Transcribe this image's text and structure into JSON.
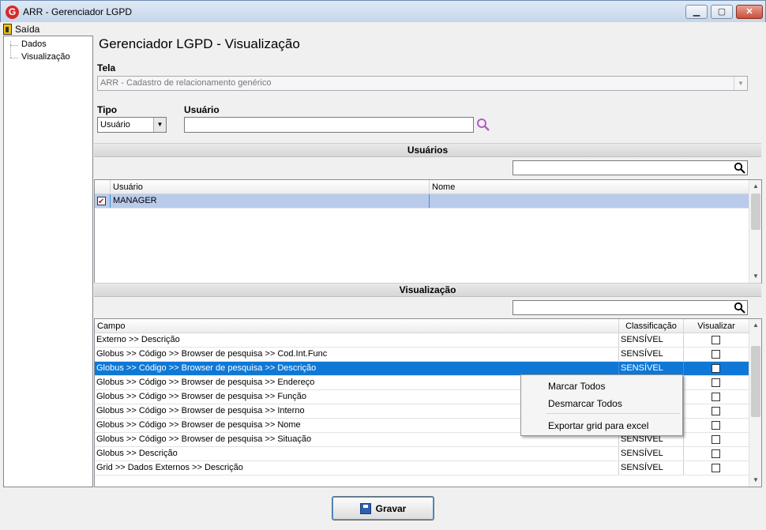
{
  "window": {
    "title": "ARR - Gerenciador LGPD",
    "icon_letter": "G"
  },
  "menu": {
    "exit_label": "Saída"
  },
  "tree": {
    "items": [
      {
        "label": "Dados"
      },
      {
        "label": "Visualização"
      }
    ]
  },
  "page": {
    "title": "Gerenciador LGPD - Visualização"
  },
  "form": {
    "tela_label": "Tela",
    "tela_value": "ARR - Cadastro de relacionamento genérico",
    "tipo_label": "Tipo",
    "tipo_value": "Usuário",
    "usuario_label": "Usuário",
    "usuario_value": ""
  },
  "users_section": {
    "title": "Usuários",
    "filter_value": "",
    "columns": [
      "Usuário",
      "Nome"
    ],
    "rows": [
      {
        "checked": true,
        "usuario": "MANAGER",
        "nome": ""
      }
    ]
  },
  "view_section": {
    "title": "Visualização",
    "filter_value": "",
    "columns": [
      "Campo",
      "Classificação",
      "Visualizar"
    ],
    "rows": [
      {
        "campo": "Externo >> Descrição",
        "classificacao": "SENSÍVEL",
        "visualizar": false
      },
      {
        "campo": "Globus >> Código >> Browser de pesquisa >> Cod.Int.Func",
        "classificacao": "SENSÍVEL",
        "visualizar": false
      },
      {
        "campo": "Globus >> Código >> Browser de pesquisa >> Descrição",
        "classificacao": "SENSÍVEL",
        "visualizar": false
      },
      {
        "campo": "Globus >> Código >> Browser de pesquisa >> Endereço",
        "classificacao": "",
        "visualizar": false
      },
      {
        "campo": "Globus >> Código >> Browser de pesquisa >> Função",
        "classificacao": "",
        "visualizar": false
      },
      {
        "campo": "Globus >> Código >> Browser de pesquisa >> Interno",
        "classificacao": "",
        "visualizar": false
      },
      {
        "campo": "Globus >> Código >> Browser de pesquisa >> Nome",
        "classificacao": "",
        "visualizar": false
      },
      {
        "campo": "Globus >> Código >> Browser de pesquisa >> Situação",
        "classificacao": "SENSÍVEL",
        "visualizar": false
      },
      {
        "campo": "Globus >> Descrição",
        "classificacao": "SENSÍVEL",
        "visualizar": false
      },
      {
        "campo": "Grid >> Dados Externos >>  Descrição",
        "classificacao": "SENSÍVEL",
        "visualizar": false
      }
    ],
    "selected_index": 2
  },
  "context_menu": {
    "items": [
      "Marcar Todos",
      "Desmarcar Todos",
      "Exportar grid para excel"
    ]
  },
  "buttons": {
    "save_label": "Gravar"
  },
  "colors": {
    "selection": "#0f78d7",
    "accent_search": "#b060c8"
  }
}
